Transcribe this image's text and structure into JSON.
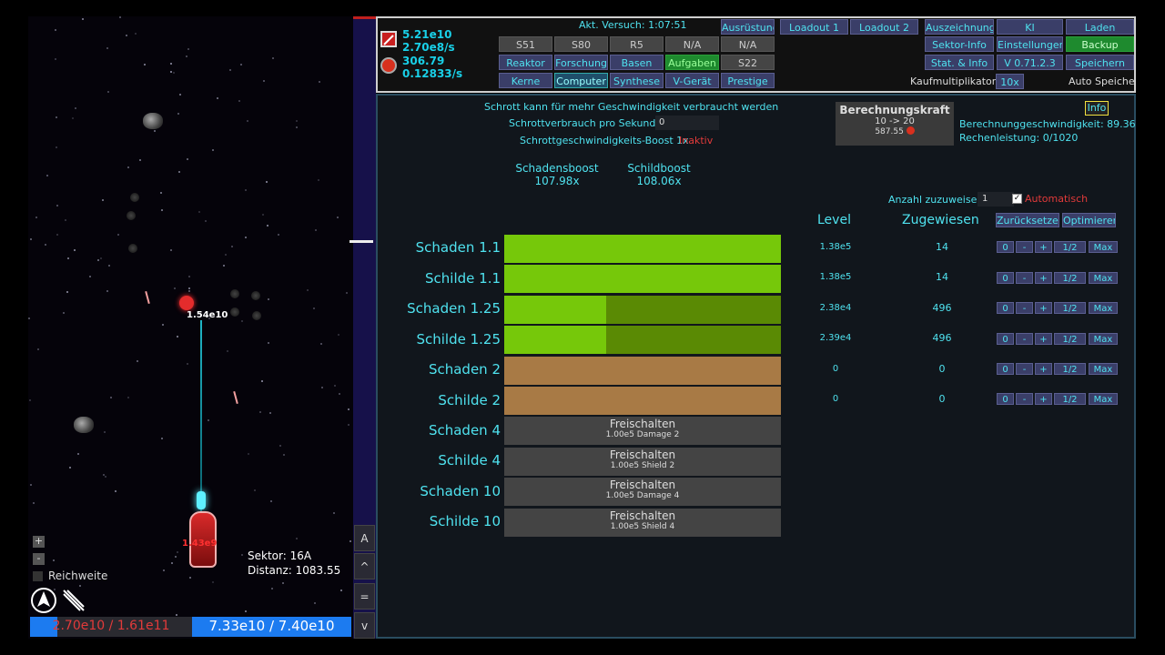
{
  "game": {
    "sector_label": "Sektor: 16A",
    "distance_label": "Distanz: 1083.55",
    "enemy_hp": "1.54e10",
    "ship_hp_label": "1.43e9",
    "reichweite": "Reichweite",
    "zoom_plus": "+",
    "zoom_minus": "-",
    "hull": "2.70e10 / 1.61e11",
    "hull_fraction": 0.17,
    "shield": "7.33e10 / 7.40e10",
    "cam_buttons": [
      "A",
      "^",
      "=",
      "v"
    ]
  },
  "resources": {
    "r1": "5.21e10",
    "r2": "2.70e8/s",
    "r3": "306.79",
    "r4": "0.12833/s"
  },
  "top": {
    "try_label": "Akt. Versuch: 1:07:51",
    "grid_row1": [
      "S51",
      "S80",
      "R5",
      "N/A"
    ],
    "grid_row2": [
      "Reaktor",
      "Forschung",
      "Basen",
      "Aufgaben"
    ],
    "grid_row3": [
      "Kerne",
      "Computer",
      "Synthese",
      "V-Gerät"
    ],
    "col5": [
      "Ausrüstung",
      "N/A",
      "S22",
      "Prestige"
    ],
    "loadout1": "Loadout 1",
    "loadout2": "Loadout 2",
    "right_row1": [
      "Auszeichnung",
      "KI",
      "Laden"
    ],
    "right_row2": [
      "Sektor-Info",
      "Einstellungen",
      "Backup"
    ],
    "right_row3": [
      "Stat. & Info",
      "V 0.71.2.3",
      "Speichern"
    ],
    "multiplier_label": "Kaufmultiplikator:",
    "multiplier_value": "10x",
    "autosave": "Auto Speichern"
  },
  "computer": {
    "scrap_info": "Schrott kann für mehr Geschwindigkeit verbraucht werden",
    "scrap_per_sec_label": "Schrottverbrauch pro Sekunde",
    "scrap_per_sec_value": "0",
    "scrap_boost_label": "Schrottgeschwindigkeits-Boost 1x",
    "scrap_boost_state": "Inaktiv",
    "calc_title": "Berechnungskraft",
    "calc_range": "10 -> 20",
    "calc_value": "587.55",
    "info_button": "Info",
    "calc_speed": "Berechnunggeschwindigkeit: 89.36",
    "calc_power": "Rechenleistung: 0/1020",
    "damage_boost_label": "Schadensboost",
    "damage_boost_value": "107.98x",
    "shield_boost_label": "Schildboost",
    "shield_boost_value": "108.06x",
    "amount_label": "Anzahl zuzuweisen",
    "amount_value": "1",
    "auto_label": "Automatisch",
    "level_header": "Level",
    "assigned_header": "Zugewiesen",
    "reset_button": "Zurücksetzen",
    "optimize_button": "Optimieren",
    "row_buttons": [
      "0",
      "-",
      "+",
      "1/2",
      "Max"
    ],
    "rows": [
      {
        "name": "Schaden 1.1",
        "level": "1.38e5",
        "assigned": "14",
        "progress": 1.0
      },
      {
        "name": "Schilde 1.1",
        "level": "1.38e5",
        "assigned": "14",
        "progress": 1.0
      },
      {
        "name": "Schaden 1.25",
        "level": "2.38e4",
        "assigned": "496",
        "progress": 0.37
      },
      {
        "name": "Schilde 1.25",
        "level": "2.39e4",
        "assigned": "496",
        "progress": 0.37
      },
      {
        "name": "Schaden 2",
        "level": "0",
        "assigned": "0"
      },
      {
        "name": "Schilde 2",
        "level": "0",
        "assigned": "0"
      }
    ],
    "locked_rows": [
      {
        "name": "Schaden 4",
        "unlock": "Freischalten",
        "cost": "1.00e5 Damage 2"
      },
      {
        "name": "Schilde 4",
        "unlock": "Freischalten",
        "cost": "1.00e5 Shield 2"
      },
      {
        "name": "Schaden 10",
        "unlock": "Freischalten",
        "cost": "1.00e5 Damage 4"
      },
      {
        "name": "Schilde 10",
        "unlock": "Freischalten",
        "cost": "1.00e5 Shield 4"
      }
    ]
  }
}
